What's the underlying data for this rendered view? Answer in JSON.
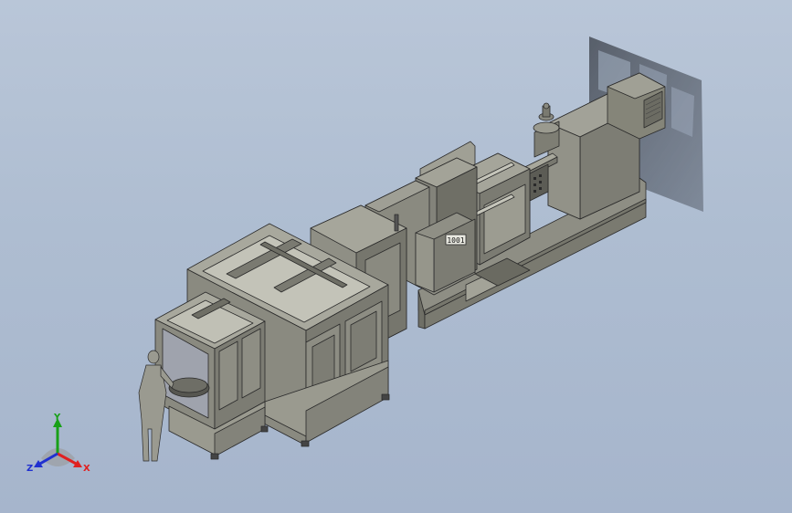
{
  "viewport": {
    "background_top": "#b9c6d8",
    "background_bottom": "#a6b5cc",
    "model_color": "#8a8a80",
    "edge_color": "#2a2a2a"
  },
  "controller_display": {
    "text": "1001"
  },
  "triad": {
    "x_label": "X",
    "y_label": "Y",
    "z_label": "Z",
    "x_color": "#e02020",
    "y_color": "#18a018",
    "z_color": "#2030d0"
  }
}
